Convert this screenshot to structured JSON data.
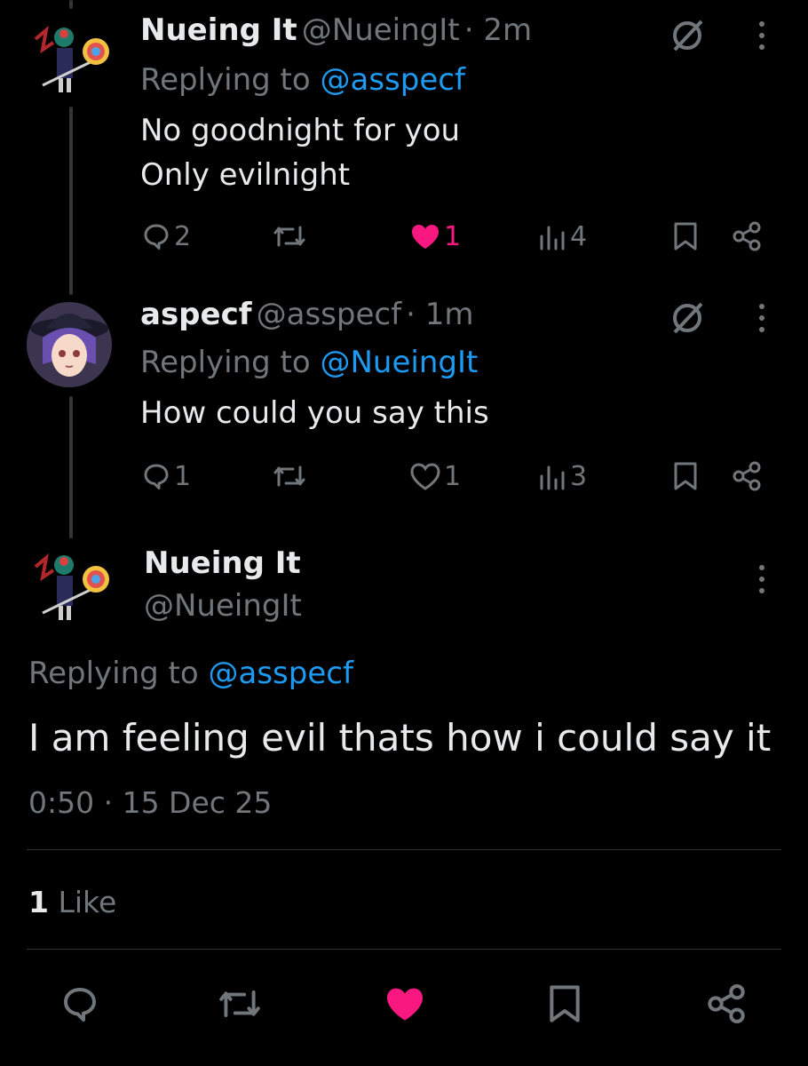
{
  "tweets": [
    {
      "name": "Nueing It",
      "handle": "@NueingIt",
      "time": "· 2m",
      "replying_label": "Replying to ",
      "replying_to": "@asspecf",
      "lines": [
        "No goodnight for you",
        "Only evilnight"
      ],
      "replies": "2",
      "retweets": "",
      "likes": "1",
      "liked": true,
      "views": "4"
    },
    {
      "name": "aspecf",
      "handle": "@asspecf",
      "time": "· 1m",
      "replying_label": "Replying to ",
      "replying_to": "@NueingIt",
      "lines": [
        "How could you say this"
      ],
      "replies": "1",
      "retweets": "",
      "likes": "1",
      "liked": false,
      "views": "3"
    }
  ],
  "main": {
    "name": "Nueing It",
    "handle": "@NueingIt",
    "replying_label": "Replying to ",
    "replying_to": "@asspecf",
    "text": "I am feeling evil thats how i could say it",
    "timestamp": "0:50 · 15 Dec 25",
    "likes_count": "1",
    "likes_label": "Like"
  },
  "colors": {
    "background": "#000000",
    "link": "#1d9bf0",
    "like": "#f91880",
    "muted": "#71767b",
    "text": "#e7e9ea"
  },
  "icons": [
    "reply-icon",
    "retweet-icon",
    "like-icon",
    "views-icon",
    "bookmark-icon",
    "share-icon",
    "grok-icon",
    "more-icon"
  ]
}
